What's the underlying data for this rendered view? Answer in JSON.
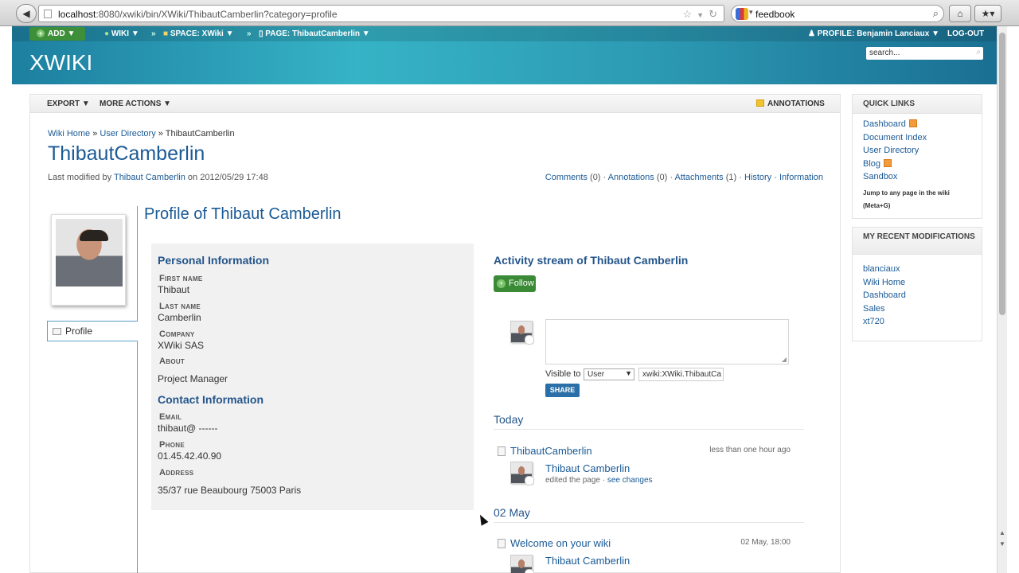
{
  "browser": {
    "back": "◀",
    "url_host": "localhost",
    "url_rest": ":8080/xwiki/bin/XWiki/ThibautCamberlin?category=profile",
    "search_query": "feedbook",
    "icons": [
      "star-icon",
      "reload-icon",
      "home-icon",
      "bookmark-icon"
    ]
  },
  "topmenu": {
    "add": "ADD ▼",
    "wiki": "WIKI ▼",
    "space": "SPACE: XWiki ▼",
    "page": "PAGE: ThibautCamberlin ▼",
    "profile": "PROFILE: Benjamin Lanciaux ▼",
    "logout": "LOG-OUT",
    "sep": "»"
  },
  "header": {
    "logo": "XWIKI",
    "search_placeholder": "search..."
  },
  "content_menu": {
    "export": "EXPORT ▼",
    "more_actions": "MORE ACTIONS ▼",
    "annotations": "ANNOTATIONS"
  },
  "breadcrumb": {
    "home": "Wiki Home",
    "sep": "»",
    "directory": "User Directory",
    "current": "ThibautCamberlin"
  },
  "page": {
    "title": "ThibautCamberlin",
    "modified_prefix": "Last modified by",
    "modified_user": "Thibaut Camberlin",
    "modified_date": "on 2012/05/29 17:48",
    "links": {
      "comments": "Comments",
      "comments_count": "(0)",
      "annotations": "Annotations",
      "annotations_count": "(0)",
      "attachments": "Attachments",
      "attachments_count": "(1)",
      "history": "History",
      "information": "Information",
      "sep": "·"
    }
  },
  "profile": {
    "tab": "Profile",
    "heading": "Profile of Thibaut Camberlin",
    "personal_title": "Personal Information",
    "contact_title": "Contact Information",
    "fields": {
      "first_name_label": "First name",
      "first_name": "Thibaut",
      "last_name_label": "Last name",
      "last_name": "Camberlin",
      "company_label": "Company",
      "company": "XWiki SAS",
      "about_label": "About",
      "about": "Project Manager",
      "email_label": "Email",
      "email": "thibaut@ ------",
      "phone_label": "Phone",
      "phone": "01.45.42.40.90",
      "address_label": "Address",
      "address": "35/37 rue Beaubourg 75003 Paris"
    }
  },
  "activity": {
    "title": "Activity stream of Thibaut Camberlin",
    "follow": "Follow",
    "visible_to": "Visible to",
    "visibility": "User",
    "target": "xwiki:XWiki.ThibautCa",
    "share": "SHARE",
    "days": [
      {
        "label": "Today",
        "page": "ThibautCamberlin",
        "time": "less than one hour ago",
        "user": "Thibaut Camberlin",
        "action": "edited the page ·",
        "link": "see changes"
      },
      {
        "label": "02 May",
        "page": "Welcome on your wiki",
        "time": "02 May, 18:00",
        "user": "Thibaut Camberlin"
      }
    ]
  },
  "quick_links": {
    "title": "QUICK LINKS",
    "items": [
      "Dashboard",
      "Document Index",
      "User Directory",
      "Blog",
      "Sandbox"
    ],
    "jump": "Jump to any page in the wiki",
    "jump_key": "(Meta+G)"
  },
  "recent": {
    "title": "MY RECENT MODIFICATIONS",
    "items": [
      "blanciaux",
      "Wiki Home",
      "Dashboard",
      "Sales",
      "xt720"
    ]
  }
}
